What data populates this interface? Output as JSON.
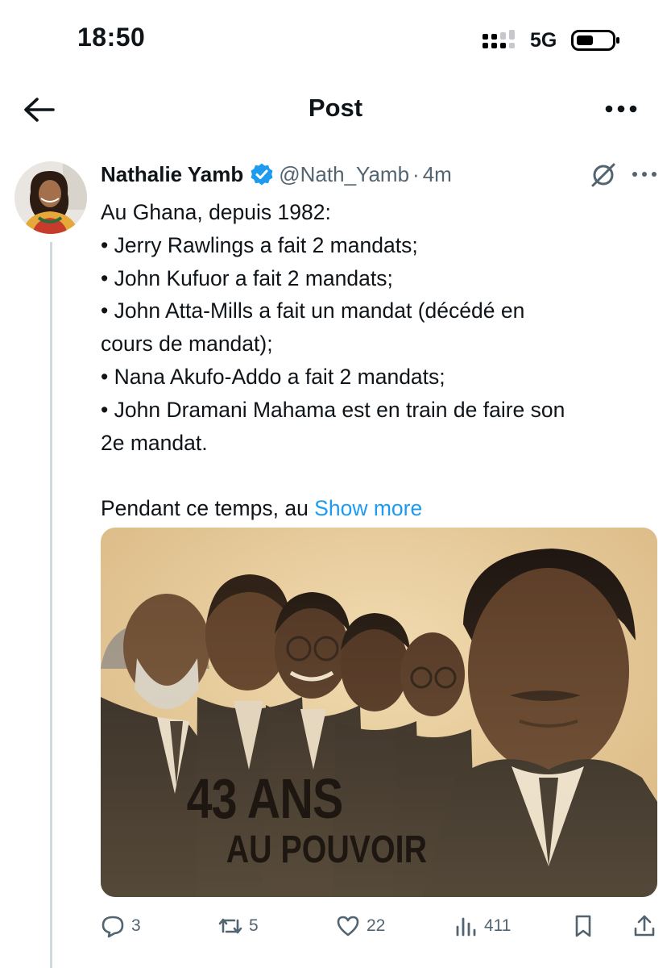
{
  "status_bar": {
    "time": "18:50",
    "network": "5G",
    "icons": [
      "signal-icon",
      "battery-icon"
    ]
  },
  "header": {
    "title": "Post",
    "icons": [
      "back-arrow-icon",
      "more-options-icon"
    ]
  },
  "post": {
    "author_name": "Nathalie Yamb",
    "handle": "@Nath_Yamb",
    "separator": "·",
    "time": "4m",
    "lines": [
      "Au Ghana, depuis 1982:",
      "• Jerry Rawlings a fait 2 mandats;",
      "• John Kufuor a fait 2 mandats;",
      "• John Atta-Mills a fait un mandat (décédé en",
      "cours de mandat);",
      "• Nana Akufo-Addo a fait 2 mandats;",
      "• John Dramani Mahama est en train de faire son",
      "2e mandat."
    ],
    "truncated_text": "Pendant ce temps, au ",
    "show_more": "Show more",
    "image_text": {
      "line1": "43 ANS",
      "line2": "AU POUVOIR"
    },
    "icons": [
      "verified-badge-icon",
      "grok-icon",
      "post-more-icon"
    ]
  },
  "actions": {
    "replies": "3",
    "reposts": "5",
    "likes": "22",
    "views": "411",
    "icons": [
      "reply-icon",
      "repost-icon",
      "like-icon",
      "views-icon",
      "bookmark-icon",
      "share-icon"
    ]
  },
  "colors": {
    "accent": "#1d9bf0",
    "text": "#0f1419",
    "secondary": "#536471",
    "thread_line": "#cfd9de"
  }
}
